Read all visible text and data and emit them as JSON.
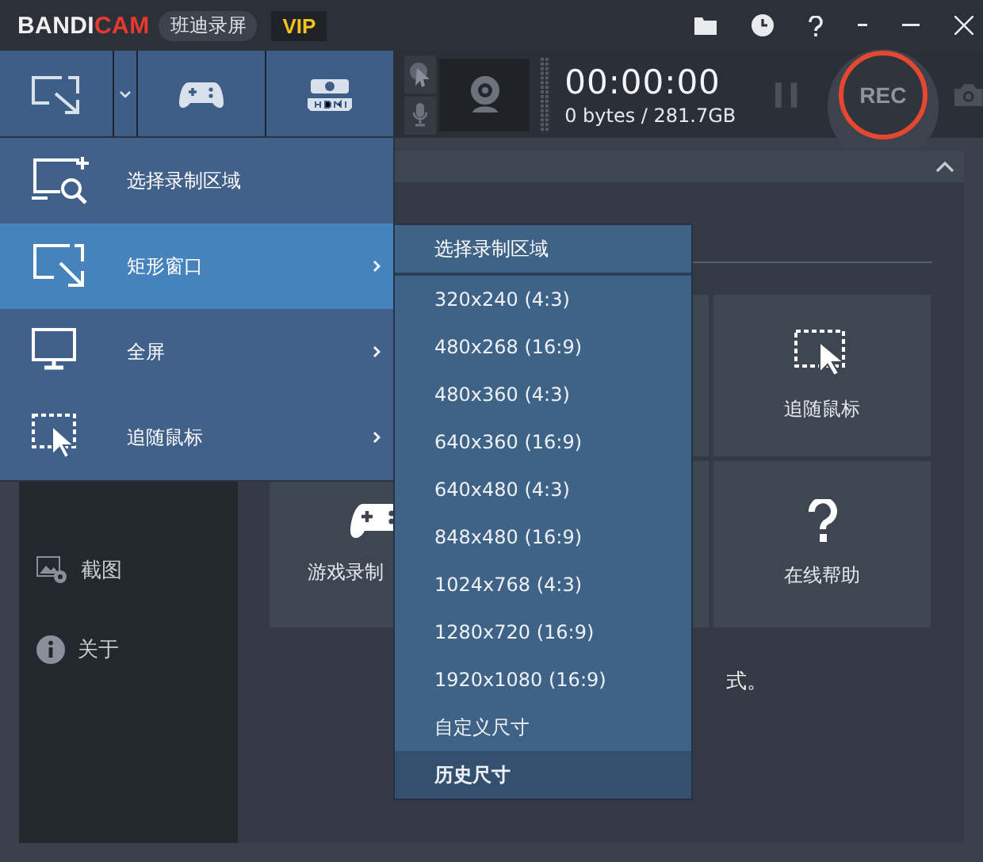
{
  "title_bar": {
    "logo_main": "BANDI",
    "logo_accent": "CAM",
    "product_name": "班迪录屏",
    "badge": "VIP"
  },
  "toolbar": {
    "timer": "00:00:00",
    "size": "0 bytes / 281.7GB",
    "rec_label": "REC"
  },
  "sidebar": {
    "items": [
      {
        "kind": "screenshot",
        "label": "截图"
      },
      {
        "kind": "about",
        "label": "关于"
      }
    ]
  },
  "tiles": [
    {
      "kind": "follow",
      "label": "追随鼠标"
    },
    {
      "kind": "game",
      "label": "游戏录制"
    },
    {
      "kind": "help",
      "label": "在线帮助"
    }
  ],
  "hint": "式。",
  "mode_menu": {
    "items": [
      {
        "kind": "select",
        "label": "选择录制区域",
        "selected": false,
        "has_submenu": false
      },
      {
        "kind": "rect",
        "label": "矩形窗口",
        "selected": true,
        "has_submenu": true
      },
      {
        "kind": "full",
        "label": "全屏",
        "selected": false,
        "has_submenu": true
      },
      {
        "kind": "follow",
        "label": "追随鼠标",
        "selected": false,
        "has_submenu": true
      }
    ]
  },
  "size_menu": {
    "header": "选择录制区域",
    "items": [
      {
        "label": "320x240 (4:3)",
        "selected": false
      },
      {
        "label": "480x268 (16:9)",
        "selected": false
      },
      {
        "label": "480x360 (4:3)",
        "selected": false
      },
      {
        "label": "640x360 (16:9)",
        "selected": false
      },
      {
        "label": "640x480 (4:3)",
        "selected": false
      },
      {
        "label": "848x480 (16:9)",
        "selected": false
      },
      {
        "label": "1024x768 (4:3)",
        "selected": false
      },
      {
        "label": "1280x720 (16:9)",
        "selected": false
      },
      {
        "label": "1920x1080 (16:9)",
        "selected": false
      },
      {
        "label": "自定义尺寸",
        "selected": false
      },
      {
        "label": "历史尺寸",
        "selected": true
      }
    ]
  }
}
